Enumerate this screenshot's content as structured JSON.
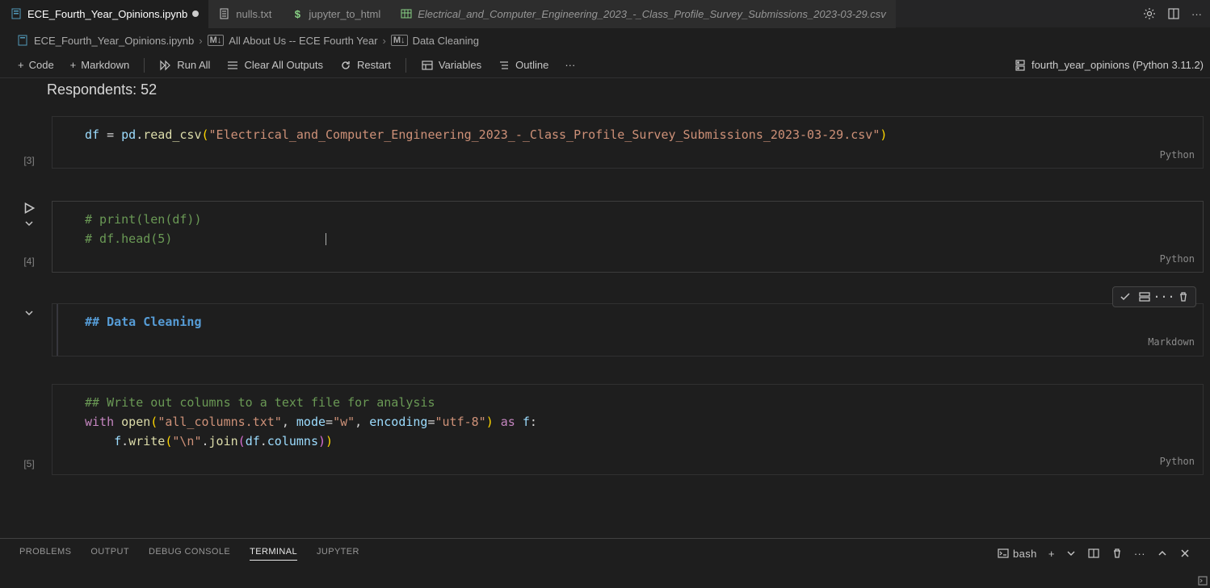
{
  "tabs": [
    {
      "icon": "notebook",
      "color": "#519aba",
      "label": "ECE_Fourth_Year_Opinions.ipynb",
      "dirty": true,
      "active": true
    },
    {
      "icon": "file",
      "color": "#c5c5c5",
      "label": "nulls.txt"
    },
    {
      "icon": "dollar",
      "color": "#89d185",
      "label": "jupyter_to_html"
    },
    {
      "icon": "table",
      "color": "#89d185",
      "label": "Electrical_and_Computer_Engineering_2023_-_Class_Profile_Survey_Submissions_2023-03-29.csv",
      "italic": true
    }
  ],
  "breadcrumb": {
    "file": "ECE_Fourth_Year_Opinions.ipynb",
    "part2_prefix": "M↓",
    "part2": "All About Us -- ECE Fourth Year",
    "part3_prefix": "M↓",
    "part3": "Data Cleaning"
  },
  "toolbar": {
    "code": "Code",
    "markdown": "Markdown",
    "run_all": "Run All",
    "clear": "Clear All Outputs",
    "restart": "Restart",
    "variables": "Variables",
    "outline": "Outline",
    "kernel": "fourth_year_opinions (Python 3.11.2)"
  },
  "heading": "Respondents: 52",
  "cells": {
    "c3": {
      "count": "[3]",
      "lang": "Python"
    },
    "c4": {
      "count": "[4]",
      "lang": "Python"
    },
    "md": {
      "lang": "Markdown"
    },
    "c5": {
      "count": "[5]",
      "lang": "Python"
    }
  },
  "code": {
    "c3": {
      "l1_id": "df",
      "l1_eq": " = ",
      "l1_mod": "pd",
      "l1_dot": ".",
      "l1_fn": "read_csv",
      "l1_p1": "(",
      "l1_str": "\"Electrical_and_Computer_Engineering_2023_-_Class_Profile_Survey_Submissions_2023-03-29.csv\"",
      "l1_p2": ")"
    },
    "c4": {
      "l1": "# print(len(df))",
      "l2": "# df.head(5)"
    },
    "md": {
      "l1": "## Data Cleaning"
    },
    "c5": {
      "l1": "## Write out columns to a text file for analysis",
      "l2_with": "with",
      "l2_sp": " ",
      "l2_open": "open",
      "l2_p1": "(",
      "l2_s1": "\"all_columns.txt\"",
      "l2_c1": ", ",
      "l2_k1": "mode",
      "l2_eq1": "=",
      "l2_s2": "\"w\"",
      "l2_c2": ", ",
      "l2_k2": "encoding",
      "l2_eq2": "=",
      "l2_s3": "\"utf-8\"",
      "l2_p2": ")",
      "l2_sp2": " ",
      "l2_as": "as",
      "l2_sp3": " ",
      "l2_f": "f",
      "l2_col": ":",
      "l3_ind": "    ",
      "l3_f": "f",
      "l3_dot": ".",
      "l3_write": "write",
      "l3_p1": "(",
      "l3_s1": "\"\\n\"",
      "l3_dot2": ".",
      "l3_join": "join",
      "l3_p2": "(",
      "l3_df": "df",
      "l3_dot3": ".",
      "l3_cols": "columns",
      "l3_p3": ")",
      "l3_p4": ")"
    }
  },
  "panel": {
    "problems": "PROBLEMS",
    "output": "OUTPUT",
    "debug": "DEBUG CONSOLE",
    "terminal": "TERMINAL",
    "jupyter": "JUPYTER",
    "shell": "bash"
  }
}
